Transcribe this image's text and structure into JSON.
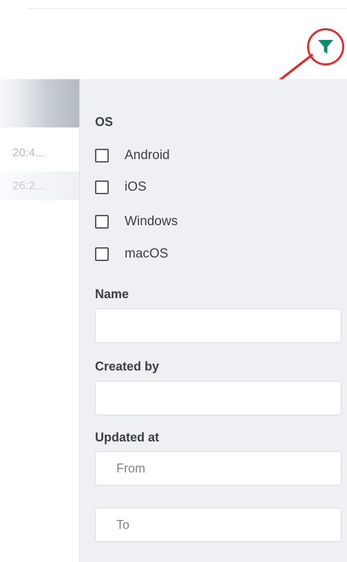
{
  "toolbar": {
    "filter_icon": "funnel-filter-icon",
    "accent_color": "#0b8a6f",
    "annotation_color": "#e32b2b"
  },
  "list": {
    "rows": [
      "20:4...",
      "26:2..."
    ]
  },
  "filter_panel": {
    "os": {
      "label": "OS",
      "options": [
        "Android",
        "iOS",
        "Windows",
        "macOS"
      ]
    },
    "name": {
      "label": "Name",
      "value": "",
      "placeholder": ""
    },
    "created_by": {
      "label": "Created by",
      "value": "",
      "placeholder": ""
    },
    "updated_at": {
      "label": "Updated at",
      "from_placeholder": "From",
      "to_placeholder": "To"
    }
  }
}
